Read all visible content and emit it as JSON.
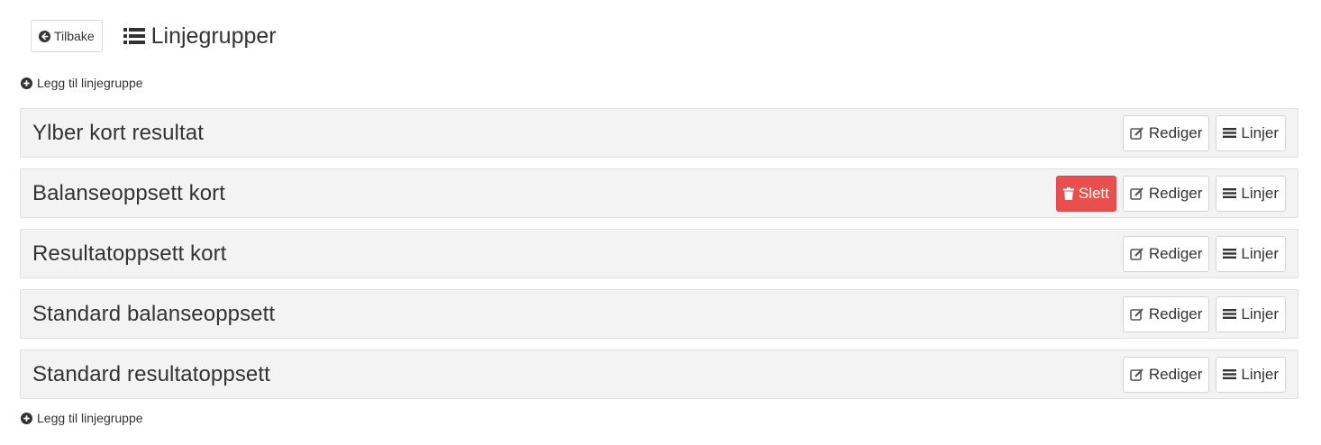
{
  "header": {
    "back_label": "Tilbake",
    "title": "Linjegrupper"
  },
  "add_label": "Legg til linjegruppe",
  "actions": {
    "delete_label": "Slett",
    "edit_label": "Rediger",
    "lines_label": "Linjer"
  },
  "groups": [
    {
      "name": "Ylber kort resultat",
      "deletable": false
    },
    {
      "name": "Balanseoppsett kort",
      "deletable": true
    },
    {
      "name": "Resultatoppsett kort",
      "deletable": false
    },
    {
      "name": "Standard balanseoppsett",
      "deletable": false
    },
    {
      "name": "Standard resultatoppsett",
      "deletable": false
    }
  ],
  "icons": {
    "back": "circle-arrow-left-icon",
    "title": "list-icon",
    "add": "plus-circle-icon",
    "delete": "trash-icon",
    "edit": "edit-icon",
    "lines": "bars-icon"
  },
  "colors": {
    "danger": "#e84f4f",
    "row_bg": "#f3f3f3"
  }
}
